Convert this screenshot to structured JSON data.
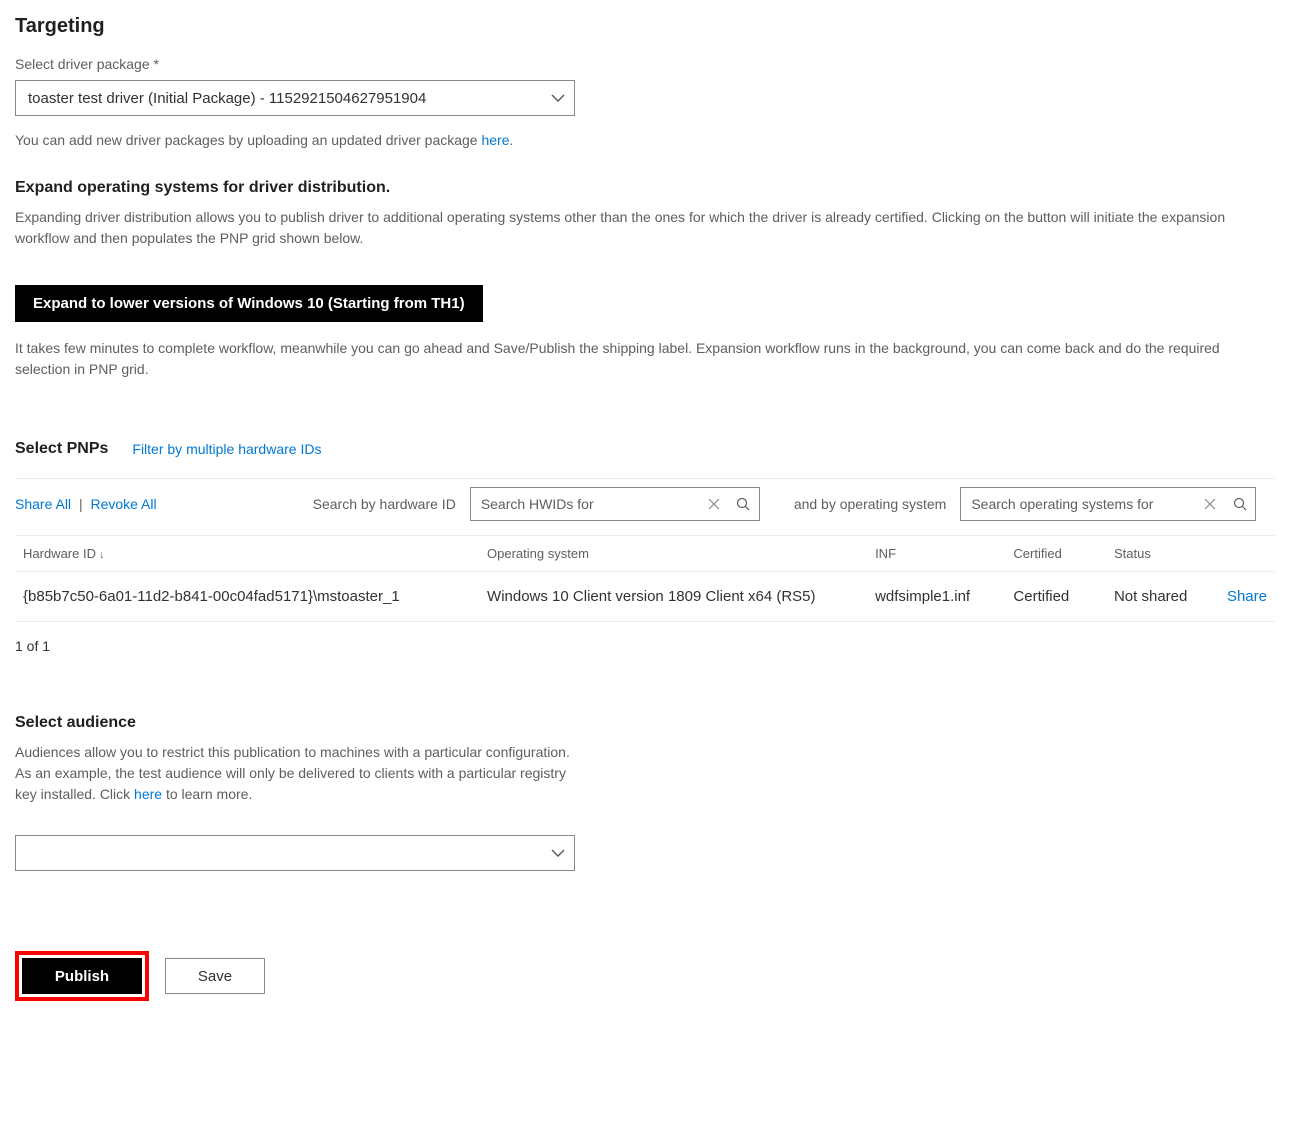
{
  "targeting": {
    "title": "Targeting",
    "driver_package_label": "Select driver package *",
    "driver_package_value": "toaster test driver (Initial Package) - 1152921504627951904",
    "upload_help_prefix": "You can add new driver packages by uploading an updated driver package ",
    "upload_help_link": "here",
    "upload_help_suffix": ".",
    "expand_heading": "Expand operating systems for driver distribution.",
    "expand_description": "Expanding driver distribution allows you to publish driver to additional operating systems other than the ones for which the driver is already certified. Clicking on the button will initiate the expansion workflow and then populates the PNP grid shown below.",
    "expand_button": "Expand to lower versions of Windows 10 (Starting from TH1)",
    "expand_note": "It takes few minutes to complete workflow, meanwhile you can go ahead and Save/Publish the shipping label. Expansion workflow runs in the background, you can come back and do the required selection in PNP grid."
  },
  "pnp": {
    "title": "Select PNPs",
    "filter_link": "Filter by multiple hardware IDs",
    "share_all": "Share All",
    "revoke_all": "Revoke All",
    "search_hwid_label": "Search by hardware ID",
    "search_hwid_placeholder": "Search HWIDs for",
    "search_os_label": "and by operating system",
    "search_os_placeholder": "Search operating systems for",
    "columns": {
      "hardware_id": "Hardware ID",
      "os": "Operating system",
      "inf": "INF",
      "certified": "Certified",
      "status": "Status"
    },
    "rows": [
      {
        "hardware_id": "{b85b7c50-6a01-11d2-b841-00c04fad5171}\\mstoaster_1",
        "os": "Windows 10 Client version 1809 Client x64 (RS5)",
        "inf": "wdfsimple1.inf",
        "certified": "Certified",
        "status": "Not shared",
        "action": "Share"
      }
    ],
    "page_info": "1 of 1"
  },
  "audience": {
    "title": "Select audience",
    "desc_prefix": "Audiences allow you to restrict this publication to machines with a particular configuration. As an example, the test audience will only be delivered to clients with a particular registry key installed. Click ",
    "desc_link": "here",
    "desc_suffix": " to learn more.",
    "value": ""
  },
  "actions": {
    "publish": "Publish",
    "save": "Save"
  }
}
